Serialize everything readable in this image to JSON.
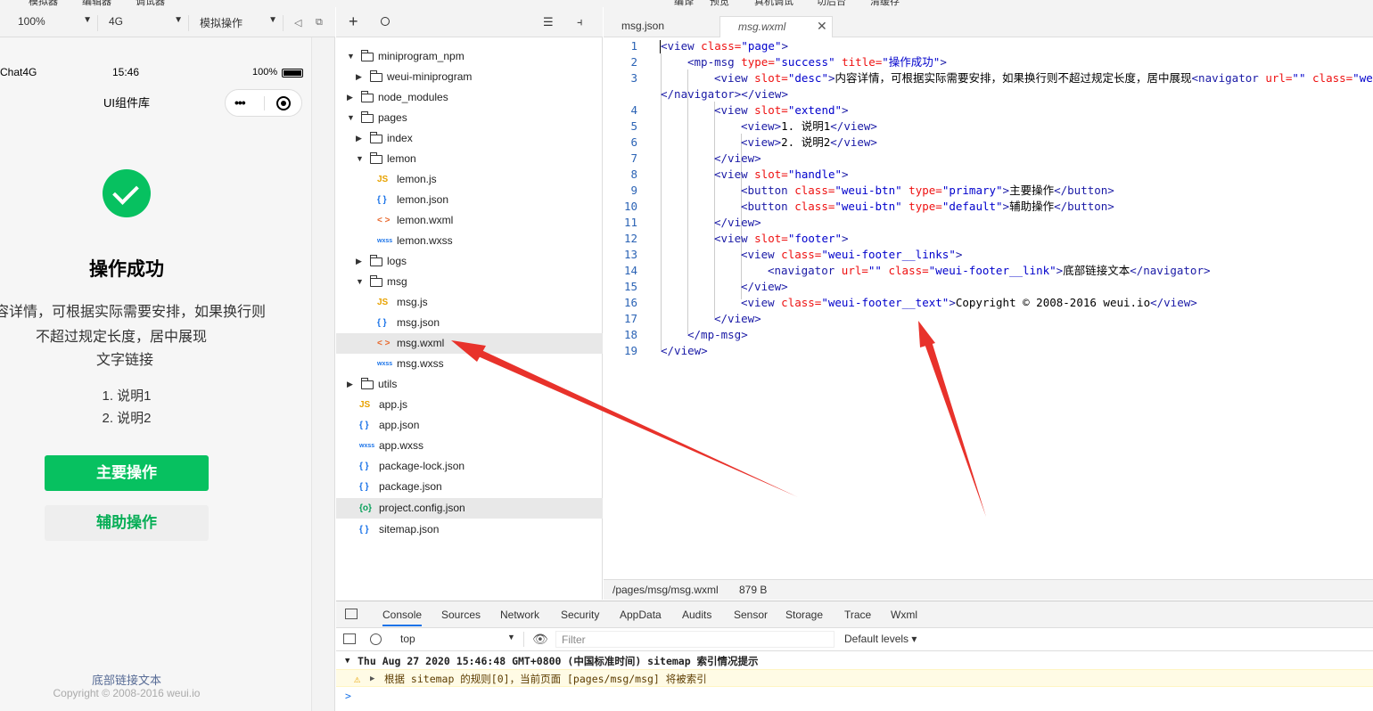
{
  "top_menu": {
    "sim": "模拟器",
    "editor": "编辑器",
    "debugger": "调试器",
    "compile": "编译",
    "preview": "预览",
    "real_debug": "真机调试",
    "backend": "切后台",
    "clear_cache": "清缓存"
  },
  "sim_toolbar": {
    "zoom": "100%",
    "network": "4G",
    "mode": "模拟操作"
  },
  "phone": {
    "carrier": "Chat4G",
    "time": "15:46",
    "battery": "100%",
    "nav_title": "UI组件库",
    "msg_title": "操作成功",
    "desc_line1": "容详情，可根据实际需要安排，如果换行则",
    "desc_line2": "不超过规定长度，居中展现",
    "desc_link": "文字链接",
    "extend1": "1. 说明1",
    "extend2": "2. 说明2",
    "primary_btn": "主要操作",
    "default_btn": "辅助操作",
    "footer_link": "底部链接文本",
    "footer_text": "Copyright © 2008-2016 weui.io"
  },
  "tree": {
    "items": [
      {
        "label": "miniprogram_npm",
        "type": "folder",
        "open": true
      },
      {
        "label": "weui-miniprogram",
        "type": "folder",
        "open": false
      },
      {
        "label": "node_modules",
        "type": "folder",
        "open": false
      },
      {
        "label": "pages",
        "type": "folder",
        "open": true
      },
      {
        "label": "index",
        "type": "folder",
        "open": false
      },
      {
        "label": "lemon",
        "type": "folder",
        "open": true
      },
      {
        "label": "lemon.js",
        "type": "js"
      },
      {
        "label": "lemon.json",
        "type": "json"
      },
      {
        "label": "lemon.wxml",
        "type": "wxml"
      },
      {
        "label": "lemon.wxss",
        "type": "wxss"
      },
      {
        "label": "logs",
        "type": "folder",
        "open": false
      },
      {
        "label": "msg",
        "type": "folder",
        "open": true
      },
      {
        "label": "msg.js",
        "type": "js"
      },
      {
        "label": "msg.json",
        "type": "json"
      },
      {
        "label": "msg.wxml",
        "type": "wxml"
      },
      {
        "label": "msg.wxss",
        "type": "wxss"
      },
      {
        "label": "utils",
        "type": "folder",
        "open": false
      },
      {
        "label": "app.js",
        "type": "js"
      },
      {
        "label": "app.json",
        "type": "json"
      },
      {
        "label": "app.wxss",
        "type": "wxss"
      },
      {
        "label": "package-lock.json",
        "type": "json"
      },
      {
        "label": "package.json",
        "type": "json"
      },
      {
        "label": "project.config.json",
        "type": "config"
      },
      {
        "label": "sitemap.json",
        "type": "json"
      }
    ],
    "icons": {
      "js": "JS",
      "json": "{ }",
      "wxml": "< >",
      "wxss": "wxss",
      "config": "{o}"
    }
  },
  "editor": {
    "tab1": "msg.json",
    "tab2": "msg.wxml",
    "line_numbers": [
      "1",
      "2",
      "3",
      "",
      "4",
      "5",
      "6",
      "7",
      "8",
      "9",
      "10",
      "11",
      "12",
      "13",
      "14",
      "15",
      "16",
      "17",
      "18",
      "19"
    ],
    "status_path": "/pages/msg/msg.wxml",
    "status_size": "879 B"
  },
  "devtools": {
    "tabs": [
      "Console",
      "Sources",
      "Network",
      "Security",
      "AppData",
      "Audits",
      "Sensor",
      "Storage",
      "Trace",
      "Wxml"
    ],
    "context": "top",
    "filter_placeholder": "Filter",
    "levels": "Default levels ▾",
    "log1": "Thu Aug 27 2020 15:46:48 GMT+0800 (中国标准时间) sitemap 索引情况提示",
    "log2": "根据 sitemap 的规则[0]，当前页面 [pages/msg/msg] 将被索引",
    "prompt": ">"
  },
  "colors": {
    "accent": "#07c160",
    "link": "#576b95",
    "arrow": "#e8322b"
  }
}
